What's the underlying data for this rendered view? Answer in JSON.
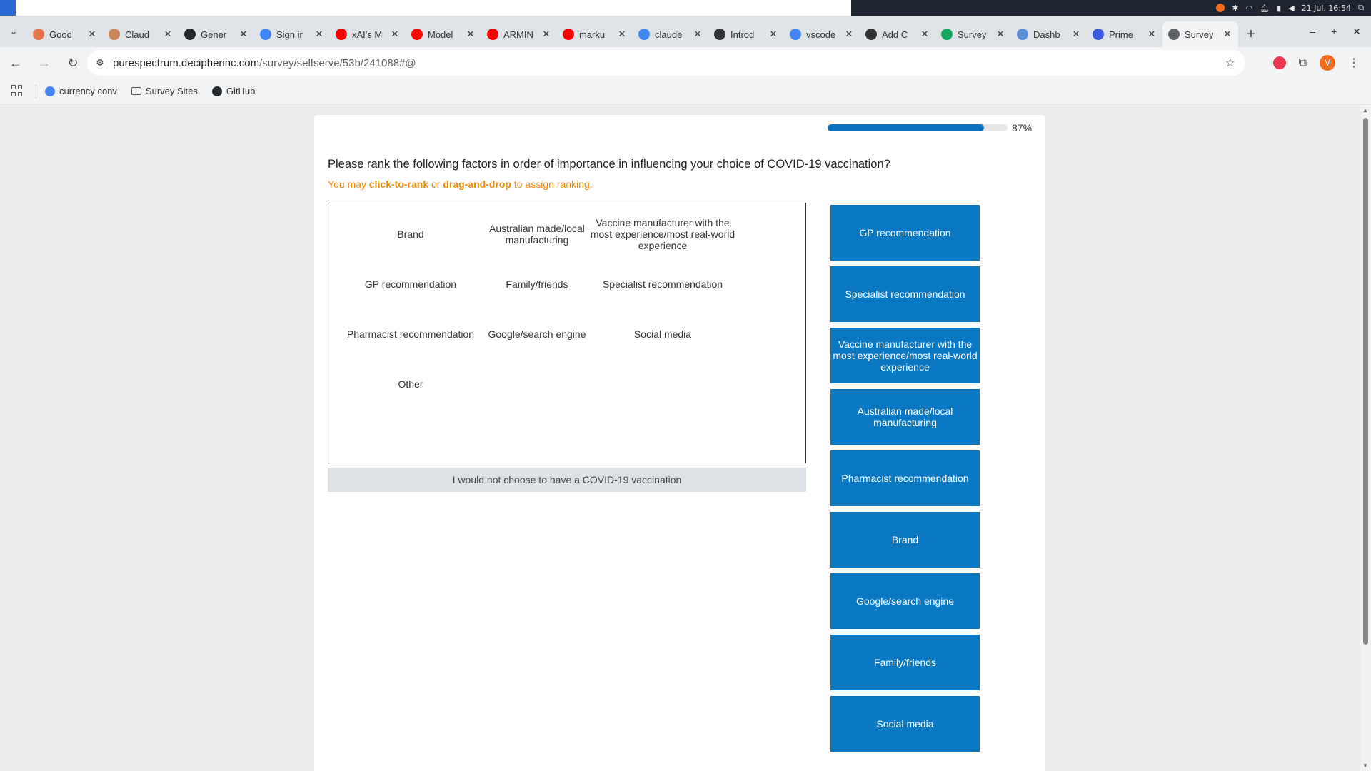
{
  "os_bar": {
    "datetime": "21 Jul, 16:54"
  },
  "tabs": [
    {
      "title": "Good",
      "color": "#e8734a"
    },
    {
      "title": "Claud",
      "color": "#c9875a"
    },
    {
      "title": "Gener",
      "color": "#24292e"
    },
    {
      "title": "Sign ir",
      "color": "#4285f4"
    },
    {
      "title": "xAI's M",
      "color": "#ff0000"
    },
    {
      "title": "Model",
      "color": "#ff0000"
    },
    {
      "title": "ARMIN",
      "color": "#ff0000"
    },
    {
      "title": "marku",
      "color": "#ff0000"
    },
    {
      "title": "claude",
      "color": "#4285f4"
    },
    {
      "title": "Introd",
      "color": "#333333"
    },
    {
      "title": "vscode",
      "color": "#4285f4"
    },
    {
      "title": "Add C",
      "color": "#333333"
    },
    {
      "title": "Survey",
      "color": "#14a760"
    },
    {
      "title": "Dashb",
      "color": "#5a8fd6"
    },
    {
      "title": "Prime",
      "color": "#3b5bdb"
    },
    {
      "title": "Survey",
      "color": "#5f6368",
      "active": true
    }
  ],
  "omnibox": {
    "host": "purespectrum.decipherinc.com",
    "path": "/survey/selfserve/53b/241088#@"
  },
  "profile": {
    "initial": "M"
  },
  "bookmarks": [
    {
      "label": "currency conv",
      "icon": "google-icon"
    },
    {
      "label": "Survey Sites",
      "icon": "folder-icon"
    },
    {
      "label": "GitHub",
      "icon": "github-icon"
    }
  ],
  "survey": {
    "progress_percent": 87,
    "progress_label": "87%",
    "question": "Please rank the following factors in order of importance in influencing your choice of COVID-19 vaccination?",
    "instruction_pre": "You may ",
    "instruction_b1": "click-to-rank",
    "instruction_mid": " or ",
    "instruction_b2": "drag-and-drop",
    "instruction_post": " to assign ranking.",
    "options": [
      "Brand",
      "Australian made/local manufacturing",
      "Vaccine manufacturer with the most experience/most real-world experience",
      "GP recommendation",
      "Family/friends",
      "Specialist recommendation",
      "Pharmacist recommendation",
      "Google/search engine",
      "Social media",
      "Other"
    ],
    "none_option": "I would not choose to have a COVID-19 vaccination",
    "ranked": [
      "GP recommendation",
      "Specialist recommendation",
      "Vaccine manufacturer with the most experience/most real-world experience",
      "Australian made/local manufacturing",
      "Pharmacist recommendation",
      "Brand",
      "Google/search engine",
      "Family/friends",
      "Social media"
    ]
  }
}
